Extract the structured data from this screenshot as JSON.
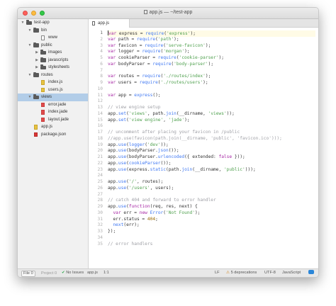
{
  "window": {
    "title": "app.js — ~/test-app"
  },
  "sidebar": {
    "items": [
      {
        "label": "test-app",
        "type": "folder",
        "expanded": true,
        "depth": 0
      },
      {
        "label": "bin",
        "type": "folder",
        "expanded": true,
        "depth": 1
      },
      {
        "label": "www",
        "type": "file",
        "depth": 2
      },
      {
        "label": "public",
        "type": "folder",
        "expanded": true,
        "depth": 1
      },
      {
        "label": "images",
        "type": "folder",
        "expanded": false,
        "depth": 2
      },
      {
        "label": "javascripts",
        "type": "folder",
        "expanded": false,
        "depth": 2
      },
      {
        "label": "stylesheets",
        "type": "folder",
        "expanded": false,
        "depth": 2
      },
      {
        "label": "routes",
        "type": "folder",
        "expanded": true,
        "depth": 1
      },
      {
        "label": "index.js",
        "type": "file-yellow",
        "depth": 2
      },
      {
        "label": "users.js",
        "type": "file-yellow",
        "depth": 2
      },
      {
        "label": "views",
        "type": "folder",
        "expanded": true,
        "depth": 1,
        "selected": true
      },
      {
        "label": "error.jade",
        "type": "file-red",
        "depth": 2
      },
      {
        "label": "index.jade",
        "type": "file-red",
        "depth": 2
      },
      {
        "label": "layout.jade",
        "type": "file-red",
        "depth": 2
      },
      {
        "label": "app.js",
        "type": "file-yellow",
        "depth": 1
      },
      {
        "label": "package.json",
        "type": "file-npm",
        "depth": 1
      }
    ]
  },
  "tabs": [
    {
      "label": "app.js"
    }
  ],
  "editor": {
    "active_line": 1,
    "lines": [
      [
        [
          "kw",
          "var"
        ],
        [
          "t",
          " express = "
        ],
        [
          "fn",
          "require"
        ],
        [
          "t",
          "("
        ],
        [
          "str",
          "'express'"
        ],
        [
          "t",
          ");"
        ]
      ],
      [
        [
          "kw",
          "var"
        ],
        [
          "t",
          " path = "
        ],
        [
          "fn",
          "require"
        ],
        [
          "t",
          "("
        ],
        [
          "str",
          "'path'"
        ],
        [
          "t",
          ");"
        ]
      ],
      [
        [
          "kw",
          "var"
        ],
        [
          "t",
          " favicon = "
        ],
        [
          "fn",
          "require"
        ],
        [
          "t",
          "("
        ],
        [
          "str",
          "'serve-favicon'"
        ],
        [
          "t",
          ");"
        ]
      ],
      [
        [
          "kw",
          "var"
        ],
        [
          "t",
          " logger = "
        ],
        [
          "fn",
          "require"
        ],
        [
          "t",
          "("
        ],
        [
          "str",
          "'morgan'"
        ],
        [
          "t",
          ");"
        ]
      ],
      [
        [
          "kw",
          "var"
        ],
        [
          "t",
          " cookieParser = "
        ],
        [
          "fn",
          "require"
        ],
        [
          "t",
          "("
        ],
        [
          "str",
          "'cookie-parser'"
        ],
        [
          "t",
          ");"
        ]
      ],
      [
        [
          "kw",
          "var"
        ],
        [
          "t",
          " bodyParser = "
        ],
        [
          "fn",
          "require"
        ],
        [
          "t",
          "("
        ],
        [
          "str",
          "'body-parser'"
        ],
        [
          "t",
          ");"
        ]
      ],
      [],
      [
        [
          "kw",
          "var"
        ],
        [
          "t",
          " routes = "
        ],
        [
          "fn",
          "require"
        ],
        [
          "t",
          "("
        ],
        [
          "str",
          "'./routes/index'"
        ],
        [
          "t",
          ");"
        ]
      ],
      [
        [
          "kw",
          "var"
        ],
        [
          "t",
          " users = "
        ],
        [
          "fn",
          "require"
        ],
        [
          "t",
          "("
        ],
        [
          "str",
          "'./routes/users'"
        ],
        [
          "t",
          ");"
        ]
      ],
      [],
      [
        [
          "kw",
          "var"
        ],
        [
          "t",
          " app = "
        ],
        [
          "fn",
          "express"
        ],
        [
          "t",
          "();"
        ]
      ],
      [],
      [
        [
          "cm",
          "// view engine setup"
        ]
      ],
      [
        [
          "t",
          "app."
        ],
        [
          "fn",
          "set"
        ],
        [
          "t",
          "("
        ],
        [
          "str",
          "'views'"
        ],
        [
          "t",
          ", path."
        ],
        [
          "fn",
          "join"
        ],
        [
          "t",
          "(__dirname, "
        ],
        [
          "str",
          "'views'"
        ],
        [
          "t",
          "));"
        ]
      ],
      [
        [
          "t",
          "app."
        ],
        [
          "fn",
          "set"
        ],
        [
          "t",
          "("
        ],
        [
          "str",
          "'view engine'"
        ],
        [
          "t",
          ", "
        ],
        [
          "str",
          "'jade'"
        ],
        [
          "t",
          ");"
        ]
      ],
      [],
      [
        [
          "cm",
          "// uncomment after placing your favicon in /public"
        ]
      ],
      [
        [
          "cm",
          "//app.use(favicon(path.join(__dirname, 'public', 'favicon.ico')));"
        ]
      ],
      [
        [
          "t",
          "app."
        ],
        [
          "fn",
          "use"
        ],
        [
          "t",
          "("
        ],
        [
          "fn",
          "logger"
        ],
        [
          "t",
          "("
        ],
        [
          "str",
          "'dev'"
        ],
        [
          "t",
          "));"
        ]
      ],
      [
        [
          "t",
          "app."
        ],
        [
          "fn",
          "use"
        ],
        [
          "t",
          "(bodyParser."
        ],
        [
          "fn",
          "json"
        ],
        [
          "t",
          "());"
        ]
      ],
      [
        [
          "t",
          "app."
        ],
        [
          "fn",
          "use"
        ],
        [
          "t",
          "(bodyParser."
        ],
        [
          "fn",
          "urlencoded"
        ],
        [
          "t",
          "({ extended: "
        ],
        [
          "kw",
          "false"
        ],
        [
          "t",
          " }));"
        ]
      ],
      [
        [
          "t",
          "app."
        ],
        [
          "fn",
          "use"
        ],
        [
          "t",
          "("
        ],
        [
          "fn",
          "cookieParser"
        ],
        [
          "t",
          "());"
        ]
      ],
      [
        [
          "t",
          "app."
        ],
        [
          "fn",
          "use"
        ],
        [
          "t",
          "(express."
        ],
        [
          "fn",
          "static"
        ],
        [
          "t",
          "(path."
        ],
        [
          "fn",
          "join"
        ],
        [
          "t",
          "(__dirname, "
        ],
        [
          "str",
          "'public'"
        ],
        [
          "t",
          ")));"
        ]
      ],
      [],
      [
        [
          "t",
          "app."
        ],
        [
          "fn",
          "use"
        ],
        [
          "t",
          "("
        ],
        [
          "str",
          "'/'"
        ],
        [
          "t",
          ", routes);"
        ]
      ],
      [
        [
          "t",
          "app."
        ],
        [
          "fn",
          "use"
        ],
        [
          "t",
          "("
        ],
        [
          "str",
          "'/users'"
        ],
        [
          "t",
          ", users);"
        ]
      ],
      [],
      [
        [
          "cm",
          "// catch 404 and forward to error handler"
        ]
      ],
      [
        [
          "t",
          "app."
        ],
        [
          "fn",
          "use"
        ],
        [
          "t",
          "("
        ],
        [
          "kw",
          "function"
        ],
        [
          "t",
          "(req, res, next) {"
        ]
      ],
      [
        [
          "t",
          "  "
        ],
        [
          "kw",
          "var"
        ],
        [
          "t",
          " err = "
        ],
        [
          "kw",
          "new"
        ],
        [
          "t",
          " "
        ],
        [
          "fn",
          "Error"
        ],
        [
          "t",
          "("
        ],
        [
          "str",
          "'Not Found'"
        ],
        [
          "t",
          ");"
        ]
      ],
      [
        [
          "t",
          "  err.status = "
        ],
        [
          "num",
          "404"
        ],
        [
          "t",
          ";"
        ]
      ],
      [
        [
          "t",
          "  "
        ],
        [
          "fn",
          "next"
        ],
        [
          "t",
          "(err);"
        ]
      ],
      [
        [
          "t",
          "});"
        ]
      ],
      [],
      [
        [
          "cm",
          "// error handlers"
        ]
      ]
    ]
  },
  "statusbar": {
    "file_tab": "File",
    "file_count": "0",
    "project_tab": "Project",
    "project_count": "0",
    "issues": "No Issues",
    "filename": "app.js",
    "cursor": "1:1",
    "line_ending": "LF",
    "deprecations": "5 deprecations",
    "encoding": "UTF-8",
    "grammar": "JavaScript"
  }
}
